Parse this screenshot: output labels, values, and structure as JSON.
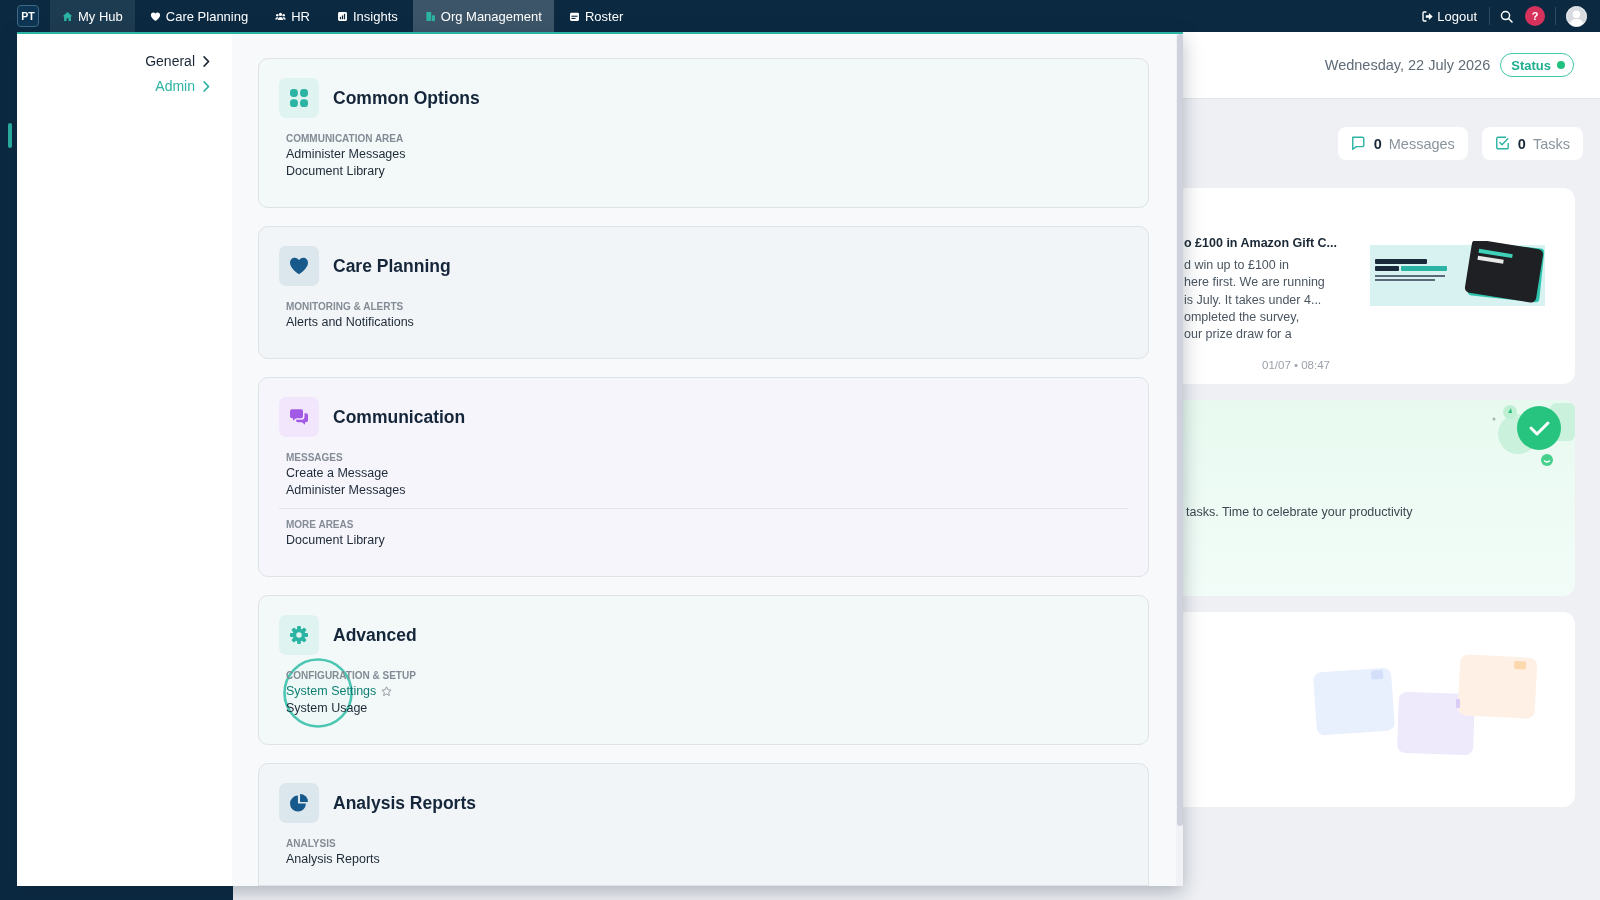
{
  "top_nav": {
    "badge": "PT",
    "tabs": [
      {
        "label": "My Hub",
        "selected": true,
        "expanded": false
      },
      {
        "label": "Care Planning",
        "selected": false,
        "expanded": false
      },
      {
        "label": "HR",
        "selected": false,
        "expanded": false
      },
      {
        "label": "Insights",
        "selected": false,
        "expanded": false
      },
      {
        "label": "Org Management",
        "selected": false,
        "expanded": true
      },
      {
        "label": "Roster",
        "selected": false,
        "expanded": false
      }
    ],
    "logout": "Logout",
    "help": "?"
  },
  "admin_menu": {
    "categories": [
      {
        "label": "General",
        "selected": false
      },
      {
        "label": "Admin",
        "selected": true
      }
    ],
    "cards": [
      {
        "title": "Common Options",
        "color": "#2bb3a3",
        "sections": [
          {
            "label": "COMMUNICATION AREA",
            "links": [
              {
                "label": "Administer Messages",
                "hovered": false
              },
              {
                "label": "Document Library",
                "hovered": false
              }
            ]
          }
        ]
      },
      {
        "title": "Care Planning",
        "color": "#17598a",
        "sections": [
          {
            "label": "MONITORING & ALERTS",
            "links": [
              {
                "label": "Alerts and Notifications",
                "hovered": false
              }
            ]
          }
        ]
      },
      {
        "title": "Communication",
        "color": "#a259e6",
        "sections": [
          {
            "label": "MESSAGES",
            "links": [
              {
                "label": "Create a Message",
                "hovered": false
              },
              {
                "label": "Administer Messages",
                "hovered": false
              }
            ]
          },
          {
            "label": "MORE AREAS",
            "links": [
              {
                "label": "Document Library",
                "hovered": false
              }
            ]
          }
        ]
      },
      {
        "title": "Advanced",
        "color": "#2bb3a3",
        "sections": [
          {
            "label": "CONFIGURATION & SETUP",
            "links": [
              {
                "label": "System Settings",
                "hovered": true
              },
              {
                "label": "System Usage",
                "hovered": false
              }
            ]
          }
        ]
      },
      {
        "title": "Analysis Reports",
        "color": "#17598a",
        "sections": [
          {
            "label": "ANALYSIS",
            "links": [
              {
                "label": "Analysis Reports",
                "hovered": false
              }
            ]
          }
        ]
      }
    ]
  },
  "dashboard": {
    "date": "Wednesday, 22 July 2026",
    "status": "Status",
    "counters": [
      {
        "count": "0",
        "label": "Messages"
      },
      {
        "count": "0",
        "label": "Tasks"
      }
    ],
    "news": {
      "title": "o £100 in Amazon Gift C...",
      "preview": "d win up to £100 in\nhere first. We are running\nis July. It takes under 4...\nompleted the survey,\nour prize draw for a",
      "time": "01/07 • 08:47"
    },
    "celebration": {
      "text": "tasks. Time to celebrate your productivity"
    }
  }
}
